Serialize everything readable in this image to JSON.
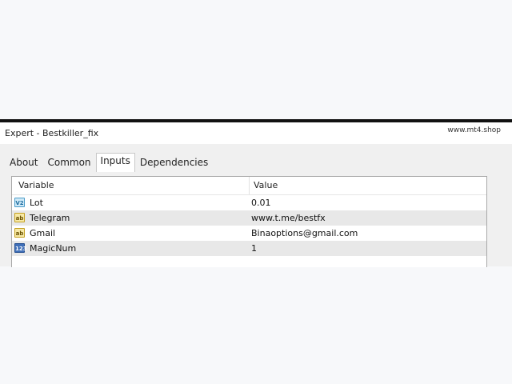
{
  "window": {
    "title": "Expert - Bestkiller_fix",
    "watermark": "www.mt4.shop"
  },
  "tabs": [
    {
      "label": "About",
      "active": false
    },
    {
      "label": "Common",
      "active": false
    },
    {
      "label": "Inputs",
      "active": true
    },
    {
      "label": "Dependencies",
      "active": false
    }
  ],
  "table": {
    "columns": [
      "Variable",
      "Value"
    ],
    "rows": [
      {
        "icon": "double-value-icon",
        "variable": "Lot",
        "value": "0.01"
      },
      {
        "icon": "string-value-icon",
        "variable": "Telegram",
        "value": "www.t.me/bestfx"
      },
      {
        "icon": "string-value-icon",
        "variable": "Gmail",
        "value": "Binaoptions@gmail.com"
      },
      {
        "icon": "integer-value-icon",
        "variable": "MagicNum",
        "value": "1"
      }
    ]
  },
  "icons": {
    "double": "V2",
    "string": "ab",
    "integer": "123"
  }
}
